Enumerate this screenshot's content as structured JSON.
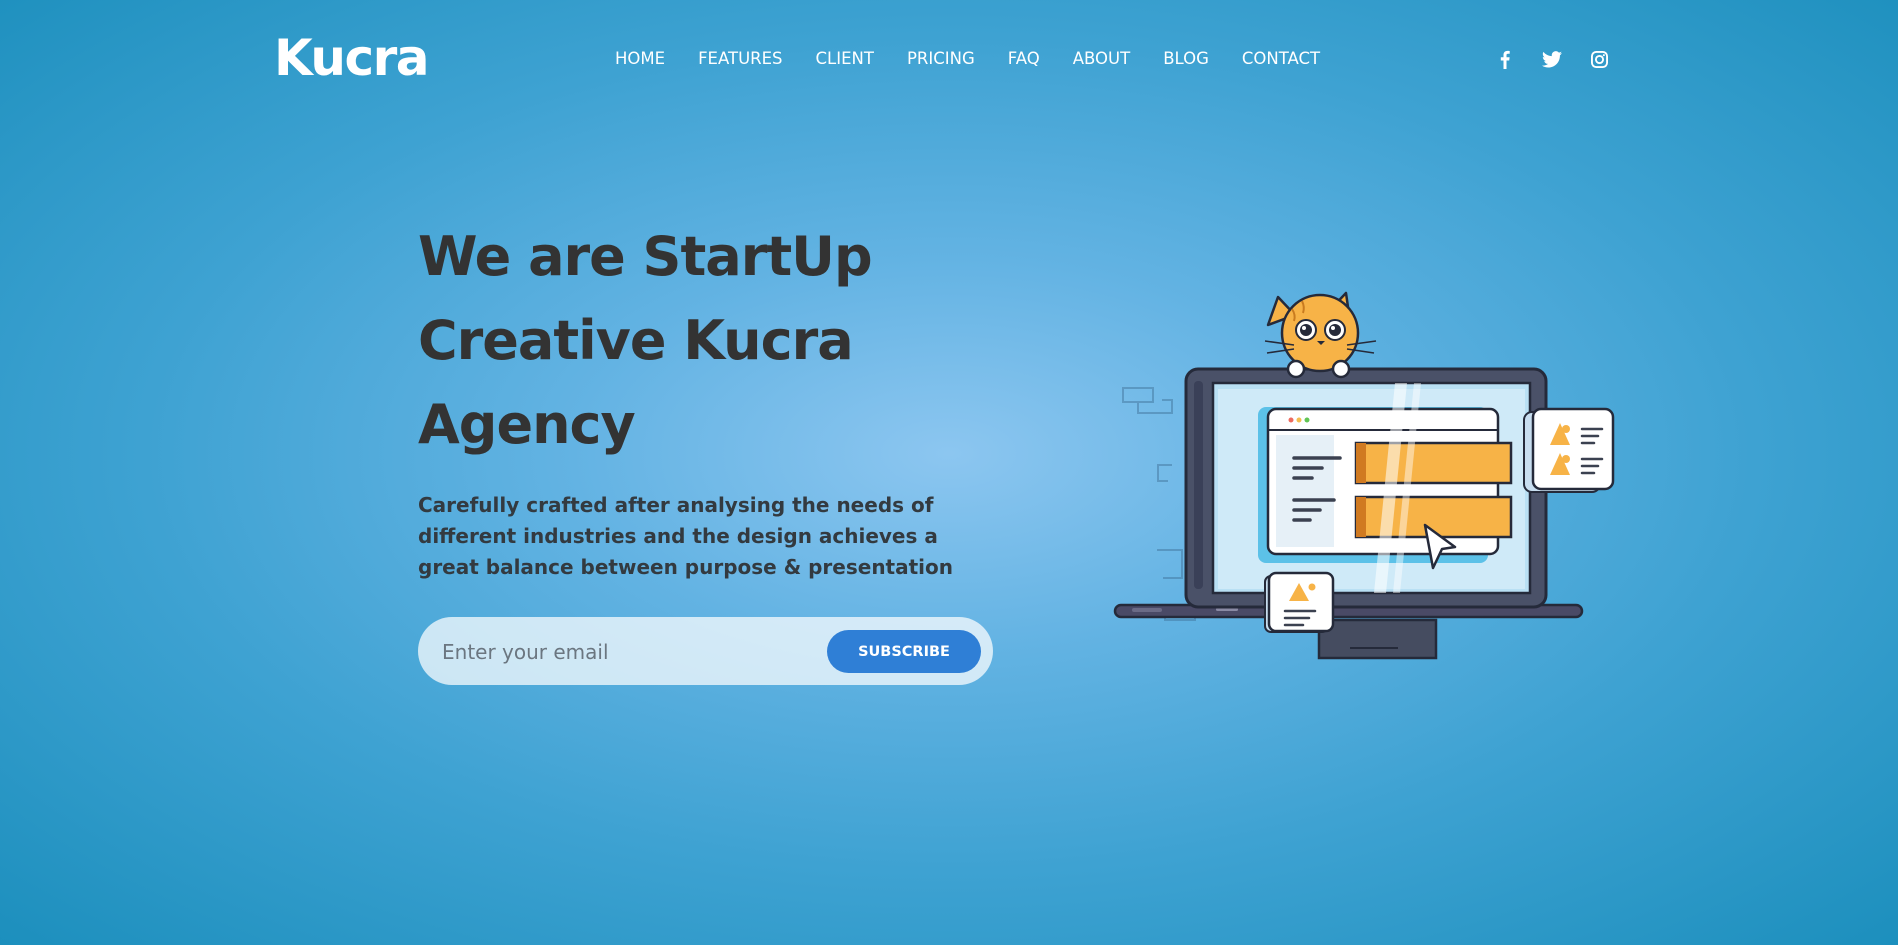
{
  "brand": {
    "logo": "Kucra"
  },
  "nav": {
    "items": [
      "HOME",
      "FEATURES",
      "CLIENT",
      "PRICING",
      "FAQ",
      "ABOUT",
      "BLOG",
      "CONTACT"
    ]
  },
  "social": {
    "icons": [
      "facebook-icon",
      "twitter-icon",
      "instagram-icon"
    ]
  },
  "hero": {
    "title_lines": [
      "We are StartUp",
      "Creative Kucra",
      "Agency"
    ],
    "description": "Carefully crafted after analysing the needs of different industries and the design achieves a great balance between purpose & presentation"
  },
  "subscribe": {
    "placeholder": "Enter your email",
    "button_label": "SUBSCRIBE"
  },
  "colors": {
    "background": "#4aa8d8",
    "accent": "#2f7fd6",
    "text_dark": "#333333",
    "illustration_orange": "#f5b042"
  }
}
